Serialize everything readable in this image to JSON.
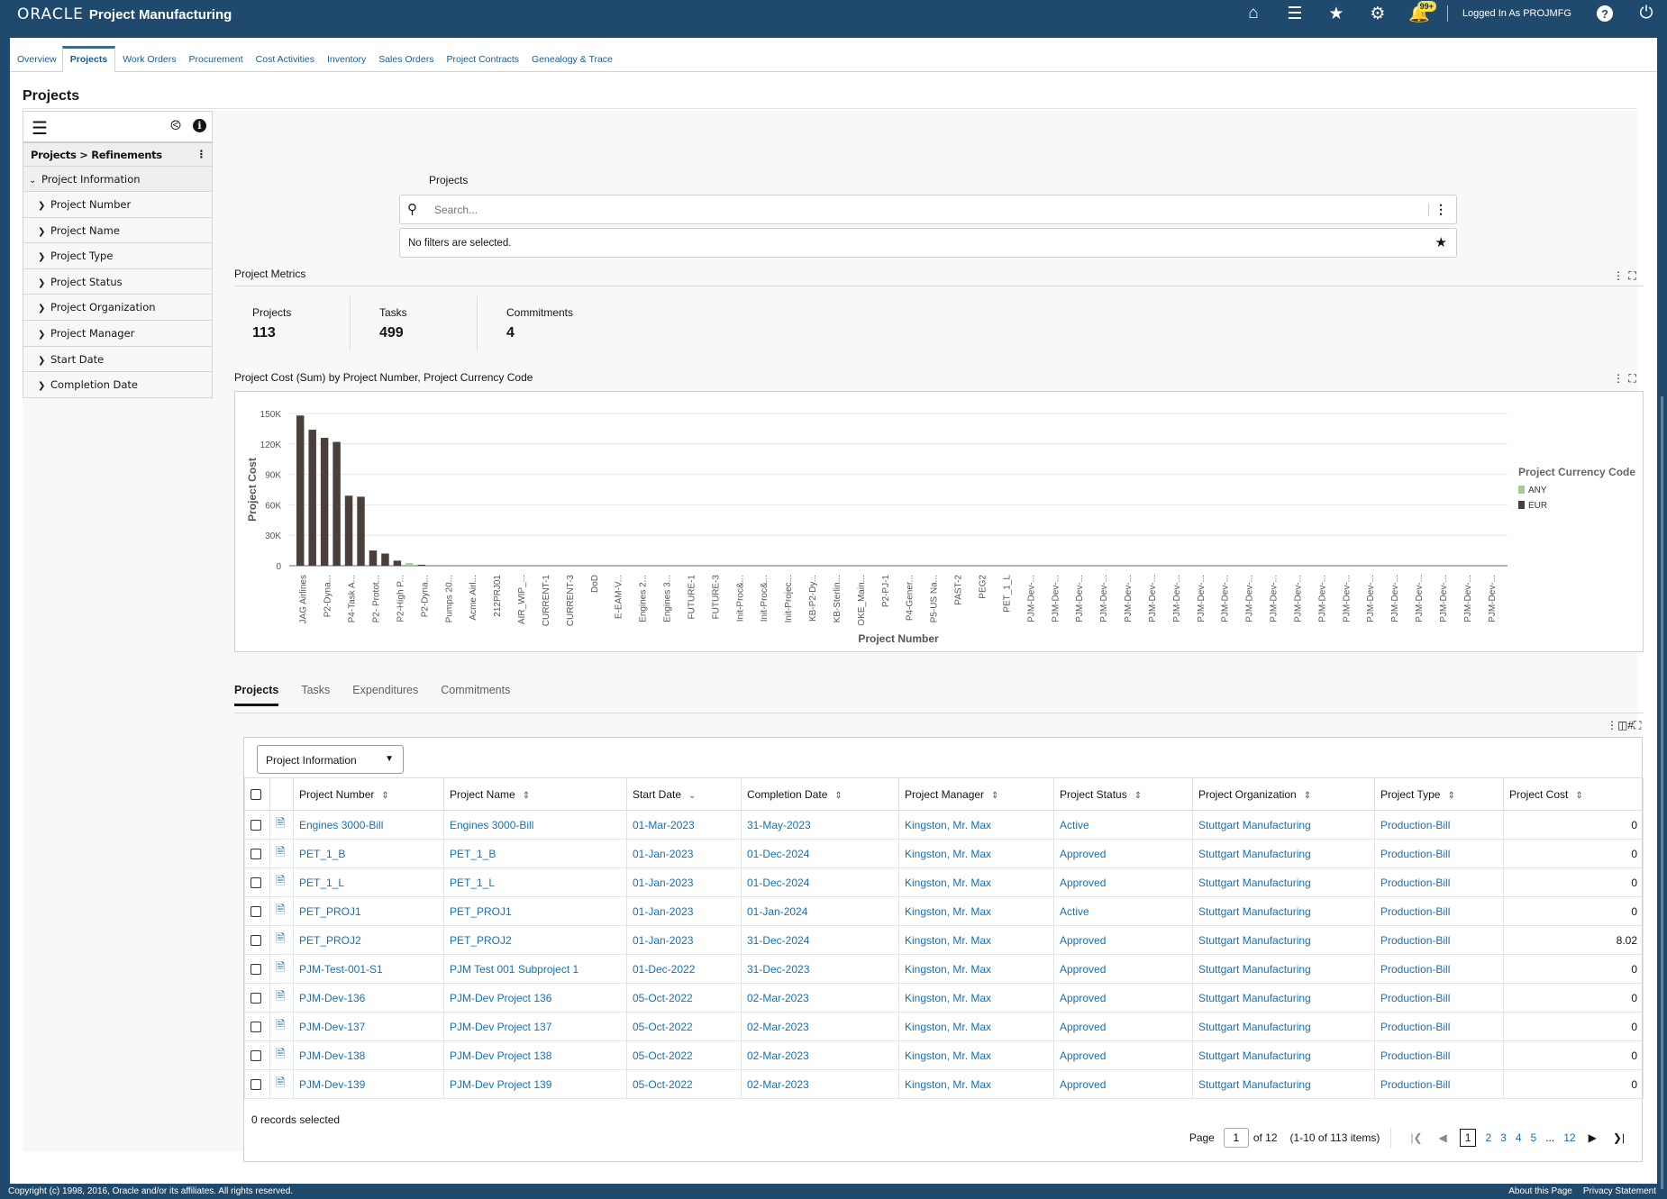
{
  "header": {
    "brand": "ORACLE",
    "app_title": "Project Manufacturing",
    "notification_badge": "99+",
    "logged_in_text": "Logged In As PROJMFG",
    "icons": [
      "home-icon",
      "menu-icon",
      "favorites-star-icon",
      "settings-gear-icon",
      "notifications-bell-icon",
      "help-icon",
      "power-icon"
    ]
  },
  "nav_tabs": [
    {
      "label": "Overview",
      "active": false
    },
    {
      "label": "Projects",
      "active": true
    },
    {
      "label": "Work Orders",
      "active": false
    },
    {
      "label": "Procurement",
      "active": false
    },
    {
      "label": "Cost Activities",
      "active": false
    },
    {
      "label": "Inventory",
      "active": false
    },
    {
      "label": "Sales Orders",
      "active": false
    },
    {
      "label": "Project Contracts",
      "active": false
    },
    {
      "label": "Genealogy & Trace",
      "active": false
    }
  ],
  "page_title": "Projects",
  "sidebar": {
    "breadcrumb": "Projects > Refinements",
    "group": "Project Information",
    "items": [
      {
        "label": "Project Number"
      },
      {
        "label": "Project Name"
      },
      {
        "label": "Project Type"
      },
      {
        "label": "Project Status"
      },
      {
        "label": "Project Organization"
      },
      {
        "label": "Project Manager"
      },
      {
        "label": "Start Date"
      },
      {
        "label": "Completion Date"
      }
    ]
  },
  "search": {
    "label": "Projects",
    "placeholder": "Search...",
    "filters_text": "No filters are selected."
  },
  "metrics": {
    "title": "Project Metrics",
    "items": [
      {
        "label": "Projects",
        "value": "113"
      },
      {
        "label": "Tasks",
        "value": "499"
      },
      {
        "label": "Commitments",
        "value": "4"
      }
    ]
  },
  "chart_section_title": "Project Cost (Sum) by Project Number, Project Currency Code",
  "chart_data": {
    "type": "bar",
    "title": "Project Cost (Sum) by Project Number, Project Currency Code",
    "xlabel": "Project Number",
    "ylabel": "Project Cost",
    "ylim": [
      0,
      150000
    ],
    "yticks": [
      "0",
      "30K",
      "60K",
      "90K",
      "120K",
      "150K"
    ],
    "ytick_values": [
      0,
      30000,
      60000,
      90000,
      120000,
      150000
    ],
    "grid": true,
    "legend": {
      "title": "Project Currency Code",
      "position": "right",
      "entries": [
        {
          "name": "ANY",
          "color": "#9fd08e"
        },
        {
          "name": "EUR",
          "color": "#4a4039"
        }
      ]
    },
    "tick_labels": [
      "JAG Airlines",
      "P2-Dyna...",
      "P4-Task A...",
      "P2- Protot...",
      "P2-High P...",
      "P2-Dyna...",
      "Pumps 20...",
      "Acme Airl...",
      "212PRJ01",
      "AIR_WIP_...",
      "CURRENT-1",
      "CURRENT-3",
      "DoD",
      "E-EAM-V...",
      "Engines 2...",
      "Engines 3...",
      "FUTURE-1",
      "FUTURE-3",
      "Init-Proc&...",
      "Init-Proc&...",
      "Init-Projec...",
      "KB-P2-Dy...",
      "KB-Sterlin...",
      "OKE_Main...",
      "P2-PJ-1",
      "P4-Gener...",
      "P5-US Na...",
      "PAST-2",
      "PEG2",
      "PET_1_L",
      "PJM-Dev-...",
      "PJM-Dev-...",
      "PJM-Dev-...",
      "PJM-Dev-...",
      "PJM-Dev-...",
      "PJM-Dev-...",
      "PJM-Dev-...",
      "PJM-Dev-...",
      "PJM-Dev-...",
      "PJM-Dev-...",
      "PJM-Dev-...",
      "PJM-Dev-...",
      "PJM-Dev-...",
      "PJM-Dev-...",
      "PJM-Dev-...",
      "PJM-Dev-...",
      "PJM-Dev-...",
      "PJM-Dev-...",
      "PJM-Dev-...",
      "PJM-Dev-..."
    ],
    "bars": [
      {
        "series": "EUR",
        "value": 148000
      },
      {
        "series": "EUR",
        "value": 134000
      },
      {
        "series": "EUR",
        "value": 126000
      },
      {
        "series": "EUR",
        "value": 122000
      },
      {
        "series": "EUR",
        "value": 69000
      },
      {
        "series": "EUR",
        "value": 68000
      },
      {
        "series": "EUR",
        "value": 15000
      },
      {
        "series": "EUR",
        "value": 12000
      },
      {
        "series": "EUR",
        "value": 5000
      },
      {
        "series": "ANY",
        "value": 2500
      },
      {
        "series": "EUR",
        "value": 1000
      }
    ],
    "total_categories": 100
  },
  "bottom_tabs": [
    {
      "label": "Projects",
      "active": true
    },
    {
      "label": "Tasks",
      "active": false
    },
    {
      "label": "Expenditures",
      "active": false
    },
    {
      "label": "Commitments",
      "active": false
    }
  ],
  "table": {
    "view_select": "Project Information",
    "columns": [
      "Project Number",
      "Project Name",
      "Start Date",
      "Completion Date",
      "Project Manager",
      "Project Status",
      "Project Organization",
      "Project Type",
      "Project Cost"
    ],
    "rows": [
      {
        "number": "Engines 3000-Bill",
        "name": "Engines 3000-Bill",
        "start": "01-Mar-2023",
        "completion": "31-May-2023",
        "manager": "Kingston, Mr. Max",
        "status": "Active",
        "org": "Stuttgart Manufacturing",
        "type": "Production-Bill",
        "cost": "0"
      },
      {
        "number": "PET_1_B",
        "name": "PET_1_B",
        "start": "01-Jan-2023",
        "completion": "01-Dec-2024",
        "manager": "Kingston, Mr. Max",
        "status": "Approved",
        "org": "Stuttgart Manufacturing",
        "type": "Production-Bill",
        "cost": "0"
      },
      {
        "number": "PET_1_L",
        "name": "PET_1_L",
        "start": "01-Jan-2023",
        "completion": "01-Dec-2024",
        "manager": "Kingston, Mr. Max",
        "status": "Approved",
        "org": "Stuttgart Manufacturing",
        "type": "Production-Bill",
        "cost": "0"
      },
      {
        "number": "PET_PROJ1",
        "name": "PET_PROJ1",
        "start": "01-Jan-2023",
        "completion": "01-Jan-2024",
        "manager": "Kingston, Mr. Max",
        "status": "Active",
        "org": "Stuttgart Manufacturing",
        "type": "Production-Bill",
        "cost": "0"
      },
      {
        "number": "PET_PROJ2",
        "name": "PET_PROJ2",
        "start": "01-Jan-2023",
        "completion": "31-Dec-2024",
        "manager": "Kingston, Mr. Max",
        "status": "Approved",
        "org": "Stuttgart Manufacturing",
        "type": "Production-Bill",
        "cost": "8.02"
      },
      {
        "number": "PJM-Test-001-S1",
        "name": "PJM Test 001 Subproject 1",
        "start": "01-Dec-2022",
        "completion": "31-Dec-2023",
        "manager": "Kingston, Mr. Max",
        "status": "Approved",
        "org": "Stuttgart Manufacturing",
        "type": "Production-Bill",
        "cost": "0"
      },
      {
        "number": "PJM-Dev-136",
        "name": "PJM-Dev Project 136",
        "start": "05-Oct-2022",
        "completion": "02-Mar-2023",
        "manager": "Kingston, Mr. Max",
        "status": "Approved",
        "org": "Stuttgart Manufacturing",
        "type": "Production-Bill",
        "cost": "0"
      },
      {
        "number": "PJM-Dev-137",
        "name": "PJM-Dev Project 137",
        "start": "05-Oct-2022",
        "completion": "02-Mar-2023",
        "manager": "Kingston, Mr. Max",
        "status": "Approved",
        "org": "Stuttgart Manufacturing",
        "type": "Production-Bill",
        "cost": "0"
      },
      {
        "number": "PJM-Dev-138",
        "name": "PJM-Dev Project 138",
        "start": "05-Oct-2022",
        "completion": "02-Mar-2023",
        "manager": "Kingston, Mr. Max",
        "status": "Approved",
        "org": "Stuttgart Manufacturing",
        "type": "Production-Bill",
        "cost": "0"
      },
      {
        "number": "PJM-Dev-139",
        "name": "PJM-Dev Project 139",
        "start": "05-Oct-2022",
        "completion": "02-Mar-2023",
        "manager": "Kingston, Mr. Max",
        "status": "Approved",
        "org": "Stuttgart Manufacturing",
        "type": "Production-Bill",
        "cost": "0"
      }
    ],
    "records_selected": "0 records selected",
    "pagination": {
      "page_label": "Page",
      "current_page": "1",
      "of_label": "of 12",
      "items_text": "(1-10 of 113 items)",
      "pages": [
        "1",
        "2",
        "3",
        "4",
        "5",
        "...",
        "12"
      ]
    }
  },
  "footer": {
    "copyright": "Copyright (c) 1998, 2016, Oracle and/or its affiliates. All rights reserved.",
    "links": [
      "About this Page",
      "Privacy Statement"
    ]
  }
}
